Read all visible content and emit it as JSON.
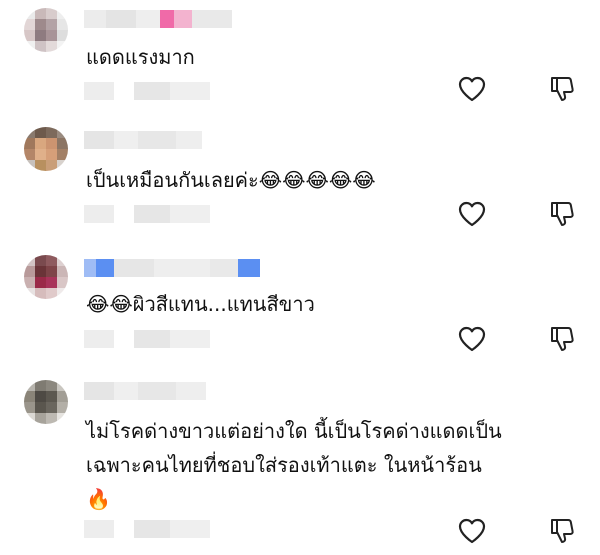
{
  "comments": [
    {
      "text": "แดดแรงมาก"
    },
    {
      "text": "เป็นเหมือนกันเลยค่ะ😂😂😂😂😂"
    },
    {
      "text": "😂😂ผิวสีแทน...แทนสีขาว"
    },
    {
      "text": "ไม่โรคด่างขาวแต่อย่างใด นี้เป็นโรคด่างแดดเป็น\nเฉพาะคนไทยที่ชอบใส่รองเท้าแตะ ในหน้าร้อน\n🔥"
    }
  ],
  "icons": {
    "like": "heart-icon",
    "dislike": "thumbs-down-icon"
  },
  "colors": {
    "icon_stroke": "#222222",
    "pixel_light": "#e9e9e9",
    "pixel_mid": "#d6d6d6",
    "accent_pink": "#f06aa8",
    "accent_blue": "#5b8ff2"
  }
}
